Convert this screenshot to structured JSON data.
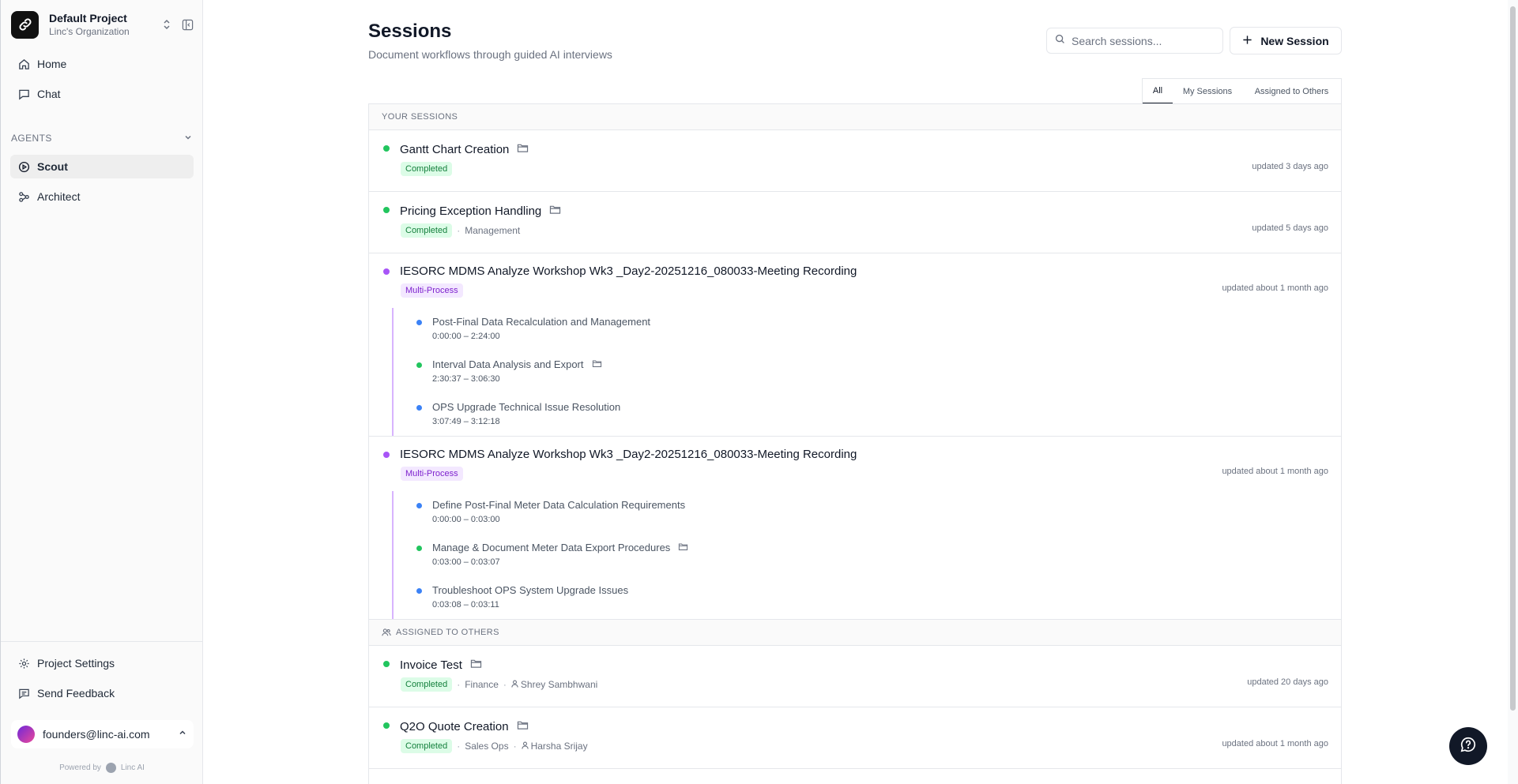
{
  "sidebar": {
    "project_name": "Default Project",
    "org_name": "Linc's Organization",
    "nav": [
      {
        "label": "Home",
        "icon": "home-icon"
      },
      {
        "label": "Chat",
        "icon": "chat-icon"
      }
    ],
    "agents_heading": "AGENTS",
    "agents": [
      {
        "label": "Scout",
        "icon": "play-circle-icon",
        "active": true
      },
      {
        "label": "Architect",
        "icon": "workflow-icon",
        "active": false
      }
    ],
    "bottom": [
      {
        "label": "Project Settings",
        "icon": "gear-icon"
      },
      {
        "label": "Send Feedback",
        "icon": "feedback-icon"
      }
    ],
    "user_email": "founders@linc-ai.com",
    "powered_by": "Powered by",
    "powered_brand": "Linc AI"
  },
  "header": {
    "title": "Sessions",
    "subtitle": "Document workflows through guided AI interviews",
    "search_placeholder": "Search sessions...",
    "new_session_label": "New Session"
  },
  "tabs": [
    {
      "label": "All",
      "active": true
    },
    {
      "label": "My Sessions",
      "active": false
    },
    {
      "label": "Assigned to Others",
      "active": false
    }
  ],
  "groups": {
    "your_sessions": "YOUR SESSIONS",
    "assigned_to_others": "ASSIGNED TO OTHERS"
  },
  "sessions": [
    {
      "title": "Gantt Chart Creation",
      "status": "Completed",
      "updated": "updated 3 days ago"
    },
    {
      "title": "Pricing Exception Handling",
      "status": "Completed",
      "category": "Management",
      "updated": "updated 5 days ago"
    },
    {
      "title": "IESORC MDMS Analyze Workshop Wk3 _Day2-20251216_080033-Meeting Recording",
      "status": "Multi-Process",
      "updated": "updated about 1 month ago",
      "subs": [
        {
          "title": "Post-Final Data Recalculation and Management",
          "time": "0:00:00 – 2:24:00"
        },
        {
          "title": "Interval Data Analysis and Export",
          "time": "2:30:37 – 3:06:30"
        },
        {
          "title": "OPS Upgrade Technical Issue Resolution",
          "time": "3:07:49 – 3:12:18"
        }
      ]
    },
    {
      "title": "IESORC MDMS Analyze Workshop Wk3 _Day2-20251216_080033-Meeting Recording",
      "status": "Multi-Process",
      "updated": "updated about 1 month ago",
      "subs": [
        {
          "title": "Define Post-Final Meter Data Calculation Requirements",
          "time": "0:00:00 – 0:03:00"
        },
        {
          "title": "Manage & Document Meter Data Export Procedures",
          "time": "0:03:00 – 0:03:07"
        },
        {
          "title": "Troubleshoot OPS System Upgrade Issues",
          "time": "0:03:08 – 0:03:11"
        }
      ]
    }
  ],
  "assigned": [
    {
      "title": "Invoice Test",
      "status": "Completed",
      "category": "Finance",
      "assignee": "Shrey Sambhwani",
      "updated": "updated 20 days ago"
    },
    {
      "title": "Q2O Quote Creation",
      "status": "Completed",
      "category": "Sales Ops",
      "assignee": "Harsha Srijay",
      "updated": "updated about 1 month ago"
    }
  ],
  "colors": {
    "completed_bg": "#dcfce7",
    "completed_text": "#15803d",
    "multi_bg": "#f3e8ff",
    "multi_text": "#7e22ce",
    "dot_green": "#22c55e",
    "dot_purple": "#a855f7",
    "dot_blue": "#3b82f6"
  }
}
